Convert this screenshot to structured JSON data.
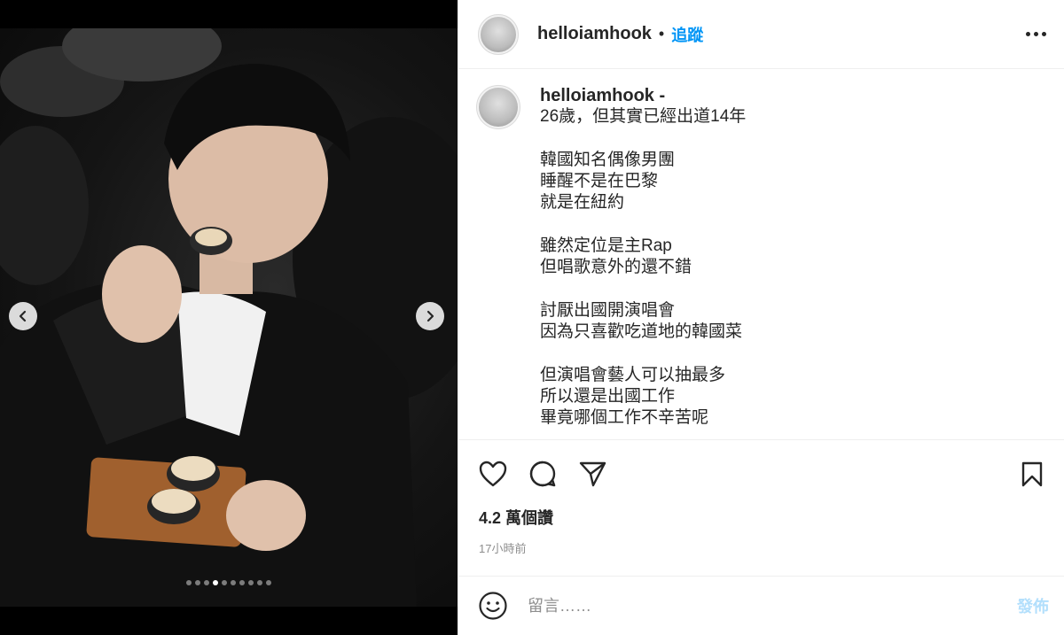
{
  "post": {
    "username": "helloiamhook",
    "separator": "•",
    "follow_label": "追蹤",
    "more_icon": "more-options-icon"
  },
  "caption": {
    "username": "helloiamhook -",
    "lines": [
      "26歲，但其實已經出道14年",
      "",
      "韓國知名偶像男團",
      "睡醒不是在巴黎",
      "就是在紐約",
      "",
      "雖然定位是主Rap",
      "但唱歌意外的還不錯",
      "",
      "討厭出國開演唱會",
      "因為只喜歡吃道地的韓國菜",
      "",
      "但演唱會藝人可以抽最多",
      "所以還是出國工作",
      "畢竟哪個工作不辛苦呢"
    ]
  },
  "stats": {
    "views": "4.2 萬個讚",
    "time_ago": "17小時前"
  },
  "comment": {
    "placeholder": "留言……",
    "post_label": "發佈"
  },
  "carousel": {
    "total": 10,
    "active_index": 3
  },
  "colors": {
    "accent": "#0095f6",
    "post_disabled": "#b2dffc",
    "muted": "#8e8e8e"
  }
}
